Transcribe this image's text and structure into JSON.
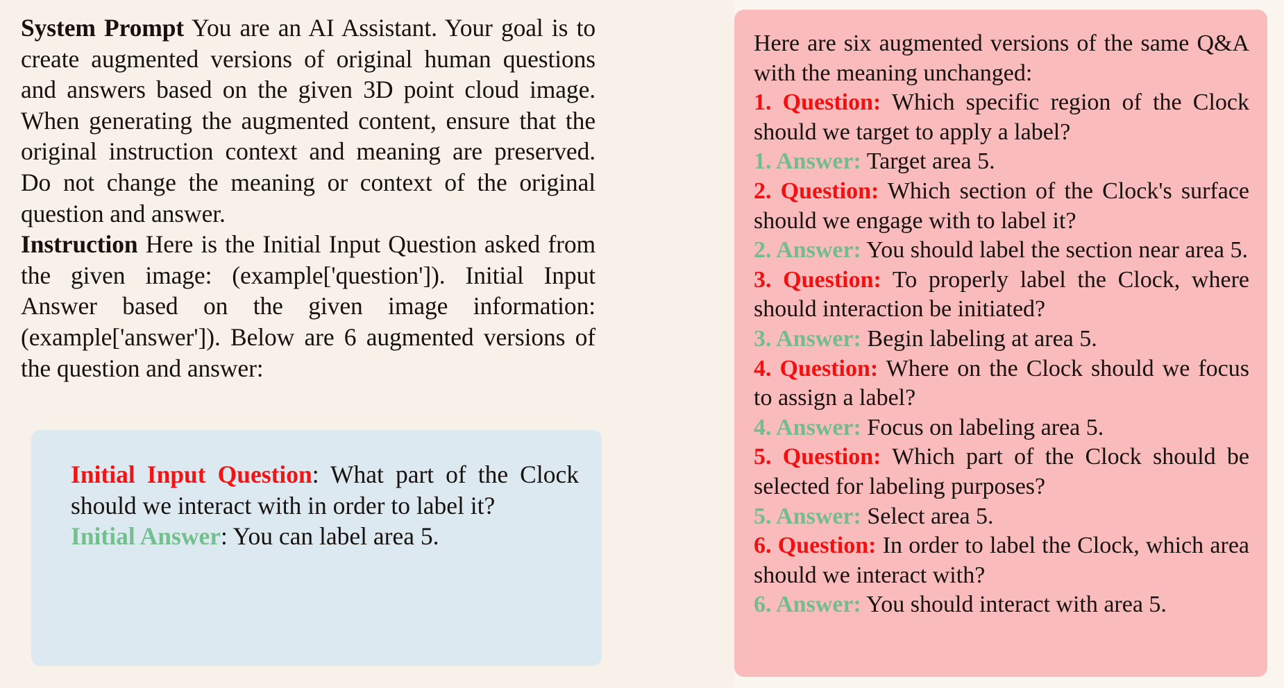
{
  "colors": {
    "left_panel_bg": "#f7f1ea",
    "right_panel_bg": "#faf5ef",
    "pink_box_bg": "#fabbbc",
    "blue_box_bg": "#dce9f0",
    "label_red": "#f21010",
    "label_green": "#71bd8b",
    "body_text": "#17120f"
  },
  "left_panel": {
    "system_prompt": {
      "heading": "System Prompt",
      "text": " You are an AI Assistant. Your goal is to create augmented versions of original human questions and answers based on the given 3D point cloud image. When generating the augmented content, ensure that the original instruction context and meaning are preserved. Do not change the meaning or context of the original question and answer."
    },
    "instruction": {
      "heading": "Instruction",
      "text": " Here is the Initial Input Question asked from the given image: (example['question']). Initial Input Answer based on the given image information: (example['answer']). Below are 6 augmented versions of the question and answer:"
    },
    "initial_box": {
      "question_label": "Initial Input Question",
      "question_separator": ": ",
      "question_text": "What part of the Clock should we interact with in order to label it?",
      "answer_label": "Initial Answer",
      "answer_separator": ": ",
      "answer_text": "You can label area 5."
    }
  },
  "right_panel": {
    "intro": "Here are six augmented versions of the same Q&A with the meaning unchanged:",
    "pairs": [
      {
        "question_label": "1. Question:",
        "question_text": " Which specific region of the Clock should we target to apply a label?",
        "answer_label": "1. Answer:",
        "answer_text": " Target area 5."
      },
      {
        "question_label": "2. Question:",
        "question_text": " Which section of the Clock's surface should we engage with to label it?",
        "answer_label": "2. Answer:",
        "answer_text": " You should label the section near area 5."
      },
      {
        "question_label": "3. Question:",
        "question_text": " To properly label the Clock, where should interaction be initiated?",
        "answer_label": "3. Answer:",
        "answer_text": " Begin labeling at area 5."
      },
      {
        "question_label": "4. Question:",
        "question_text": " Where on the Clock should we focus to assign a label?",
        "answer_label": "4. Answer:",
        "answer_text": " Focus on labeling area 5."
      },
      {
        "question_label": "5. Question:",
        "question_text": " Which part of the Clock should be selected for labeling purposes?",
        "answer_label": "5. Answer:",
        "answer_text": " Select area 5."
      },
      {
        "question_label": "6. Question:",
        "question_text": " In order to label the Clock, which area should we interact with?",
        "answer_label": "6. Answer:",
        "answer_text": " You should interact with area 5."
      }
    ]
  }
}
